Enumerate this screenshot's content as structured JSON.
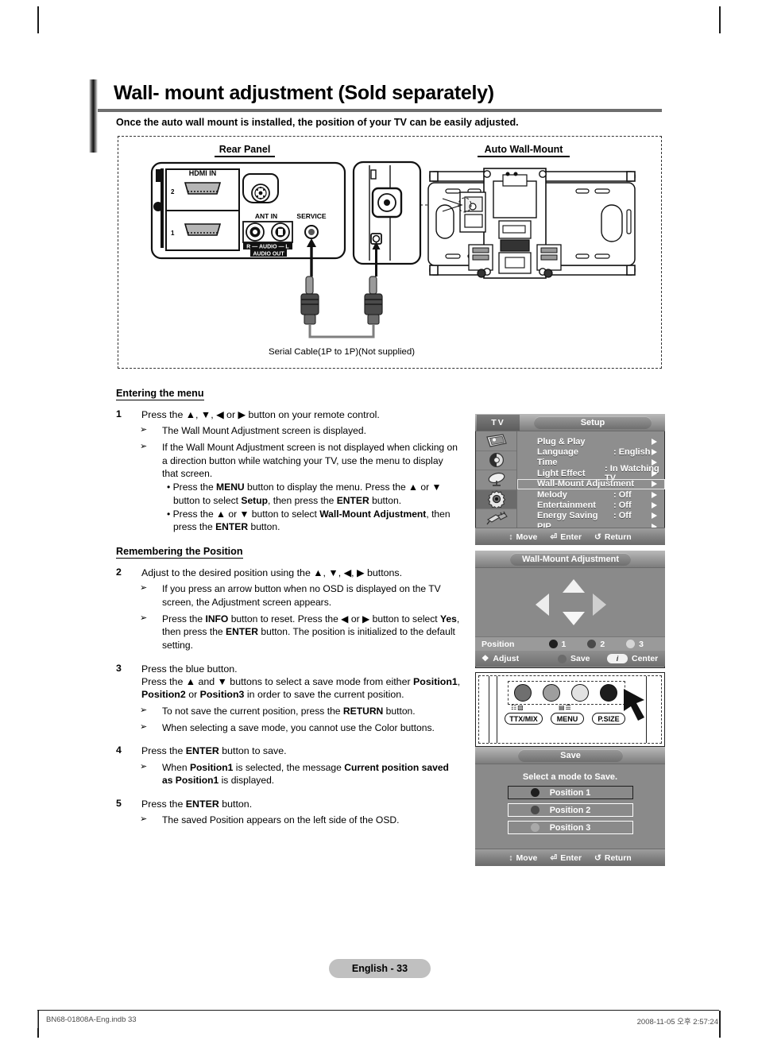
{
  "header": {
    "title": "Wall- mount adjustment (Sold separately)",
    "subtitle": "Once the auto wall mount is installed, the position of your TV can be easily adjusted."
  },
  "figure": {
    "caption_rear_panel": "Rear Panel",
    "caption_auto_wall_mount": "Auto Wall-Mount",
    "serial_cable_caption": "Serial Cable(1P to 1P)(Not supplied)",
    "rear_panel_labels": {
      "hdmi_in": "HDMI IN",
      "hdmi_port_2": "2",
      "hdmi_port_1": "1",
      "ant_in": "ANT IN",
      "service": "SERVICE",
      "audio_r": "R",
      "audio": "AUDIO",
      "audio_l": "L",
      "audio_out": "AUDIO OUT"
    }
  },
  "sections": {
    "entering_the_menu": {
      "title": "Entering the menu",
      "steps": [
        {
          "num": "1",
          "text_html": "Press the ▲, ▼, ◀ or ▶ button on your remote control.",
          "subs": [
            {
              "mark": "➢",
              "text_html": "The Wall Mount Adjustment screen is displayed."
            },
            {
              "mark": "➢",
              "text_html": "If the Wall Mount Adjustment screen is not displayed when clicking on a direction button while watching your TV, use the menu to display that screen.",
              "bullets": [
                "• Press the <b>MENU</b> button to display the menu. Press the ▲ or ▼ button to select <b>Setup</b>, then press the <b>ENTER</b> button.",
                "• Press the ▲ or ▼ button to select <b>Wall-Mount Adjustment</b>, then press the <b>ENTER</b> button."
              ]
            }
          ]
        }
      ]
    },
    "remembering_the_position": {
      "title": "Remembering the Position",
      "steps": [
        {
          "num": "2",
          "text_html": "Adjust to the desired position using the ▲, ▼, ◀, ▶ buttons.",
          "subs": [
            {
              "mark": "➢",
              "text_html": "If you press an arrow button when no OSD is displayed on the TV screen, the Adjustment screen appears."
            },
            {
              "mark": "➢",
              "text_html": "Press the <b>INFO</b> button to reset. Press the ◀ or ▶ button to select <b>Yes</b>, then press the <b>ENTER</b> button. The position is initialized to the default setting."
            }
          ]
        },
        {
          "num": "3",
          "text_html": "Press the blue button.<br>Press the ▲ and ▼ buttons to select a save mode from either <b>Position1</b>, <b>Position2</b> or <b>Position3</b> in order to save the current position.",
          "subs": [
            {
              "mark": "➢",
              "text_html": "To not save the current position, press the <b>RETURN</b> button."
            },
            {
              "mark": "➢",
              "text_html": "When selecting a save mode, you cannot use the Color buttons."
            }
          ]
        },
        {
          "num": "4",
          "text_html": "Press the <b>ENTER</b> button to save.",
          "subs": [
            {
              "mark": "➢",
              "text_html": "When <b>Position1</b> is selected, the message <b>Current position saved as Position1</b> is displayed."
            }
          ]
        },
        {
          "num": "5",
          "text_html": "Press the <b>ENTER</b> button.",
          "subs": [
            {
              "mark": "➢",
              "text_html": "The saved Position appears on the left side of the OSD."
            }
          ]
        }
      ]
    }
  },
  "osd_setup": {
    "tv_tab": "TV",
    "title": "Setup",
    "rail_icons": [
      "picture-icon",
      "sound-icon",
      "channel-icon",
      "setup-gear-icon",
      "input-plug-icon"
    ],
    "rail_selected_index": 3,
    "rows": [
      {
        "label": "Plug & Play",
        "value": "",
        "highlighted": false
      },
      {
        "label": "Language",
        "value": ": English",
        "highlighted": false
      },
      {
        "label": "Time",
        "value": "",
        "highlighted": false
      },
      {
        "label": "Light Effect",
        "value": ": In Watching TV",
        "highlighted": false
      },
      {
        "label": "Wall-Mount Adjustment",
        "value": "",
        "highlighted": true
      },
      {
        "label": "Melody",
        "value": ": Off",
        "highlighted": false
      },
      {
        "label": "Entertainment",
        "value": ": Off",
        "highlighted": false
      },
      {
        "label": "Energy Saving",
        "value": ": Off",
        "highlighted": false
      },
      {
        "label": "PIP",
        "value": "",
        "highlighted": false
      }
    ],
    "footer": {
      "move": "Move",
      "enter": "Enter",
      "return": "Return"
    }
  },
  "osd_wall_mount": {
    "title": "Wall-Mount Adjustment",
    "arrows": [
      "up-arrow",
      "down-arrow",
      "left-arrow",
      "right-arrow"
    ],
    "position_label": "Position",
    "positions": [
      {
        "num": "1",
        "color": "#1e1e1e"
      },
      {
        "num": "2",
        "color": "#4a4a4a"
      },
      {
        "num": "3",
        "color": "#d6d6d6"
      }
    ],
    "footer": {
      "adjust": "Adjust",
      "save": "Save",
      "center": "Center",
      "info_glyph": "i"
    }
  },
  "remote": {
    "buttons": [
      {
        "name": "red-button",
        "color": "#6f6f6f"
      },
      {
        "name": "green-button",
        "color": "#9e9e9e"
      },
      {
        "name": "yellow-button",
        "color": "#e2e2e2"
      },
      {
        "name": "blue-button",
        "color": "#1d1d1d"
      }
    ],
    "labels": [
      "TTX/MIX",
      "MENU",
      "P.SIZE"
    ]
  },
  "osd_save": {
    "title": "Save",
    "prompt": "Select a mode to Save.",
    "options": [
      {
        "label": "Position 1",
        "color": "#1e1e1e"
      },
      {
        "label": "Position 2",
        "color": "#4a4a4a"
      },
      {
        "label": "Position 3",
        "color": "#a9a9a9"
      }
    ],
    "footer": {
      "move": "Move",
      "enter": "Enter",
      "return": "Return"
    }
  },
  "footer": {
    "page_badge": "English - 33",
    "file_ref": "BN68-01808A-Eng.indb   33",
    "timestamp": "2008-11-05   오후 2:57:24"
  }
}
